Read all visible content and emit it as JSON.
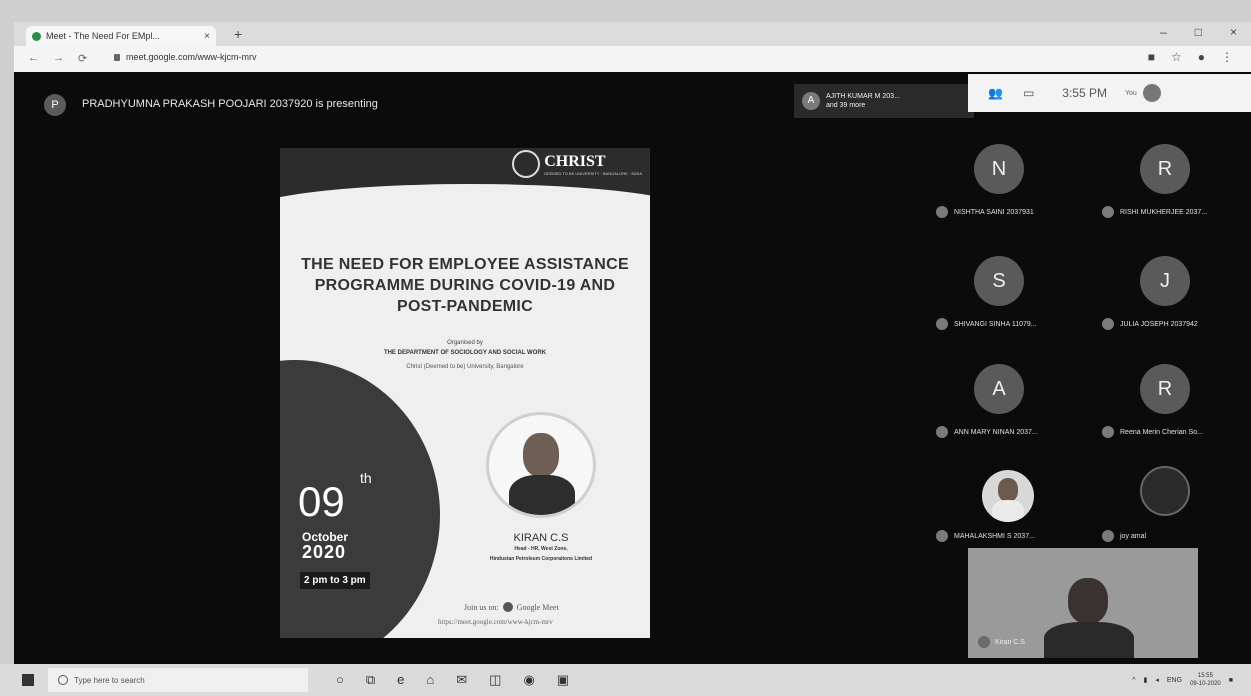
{
  "browser": {
    "tab_title": "Meet - The Need For EMpl...",
    "url": "meet.google.com/www-kjcm-mrv",
    "new_tab": "+",
    "win_controls": [
      "–",
      "□",
      "×"
    ],
    "nav": [
      "←",
      "→",
      "⟳"
    ]
  },
  "meet": {
    "presenter_initial": "P",
    "presenting_text": "PRADHYUMNA PRAKASH POOJARI 2037920 is presenting",
    "joined_initial": "A",
    "joined_line1": "AJITH KUMAR M 203...",
    "joined_line2": "and 39 more",
    "clock": "3:55 PM",
    "you_label": "You"
  },
  "slide": {
    "university": "CHRIST",
    "university_sub": "DEEMED TO BE UNIVERSITY · BANGALORE · INDIA",
    "title": "THE NEED FOR EMPLOYEE ASSISTANCE PROGRAMME DURING COVID-19 AND POST-PANDEMIC",
    "organised_by": "Organised by",
    "department": "THE DEPARTMENT OF SOCIOLOGY AND SOCIAL WORK",
    "institution": "Christ (Deemed to be) University, Bangalore",
    "day": "09",
    "day_suffix": "th",
    "month": "October",
    "year": "2020",
    "time": "2 pm to 3 pm",
    "speaker_name": "KIRAN C.S",
    "speaker_role": "Head - HR, West Zone,",
    "speaker_org": "Hindustan Petroleum Corporations Limited",
    "join_text": "Join us on:",
    "join_app": "Google Meet",
    "join_link": "https://meet.google.com/www-kjcm-mrv"
  },
  "participants": [
    {
      "initial": "N",
      "name": "NISHTHA SAINI 2037931"
    },
    {
      "initial": "R",
      "name": "RISHI MUKHERJEE 2037..."
    },
    {
      "initial": "S",
      "name": "SHIVANGI SINHA 11079..."
    },
    {
      "initial": "J",
      "name": "JULIA JOSEPH 2037942"
    },
    {
      "initial": "A",
      "name": "ANN MARY NINAN 2037..."
    },
    {
      "initial": "R",
      "name": "Reena Merin Cherian So..."
    },
    {
      "initial": "",
      "name": "MAHALAKSHMI S 2037..."
    },
    {
      "initial": "",
      "name": "joy amal"
    }
  ],
  "self_view": {
    "name": "Kiran C.S"
  },
  "taskbar": {
    "search_placeholder": "Type here to search",
    "tray_lang": "ENG",
    "tray_time": "15:55",
    "tray_date": "09-10-2020"
  }
}
